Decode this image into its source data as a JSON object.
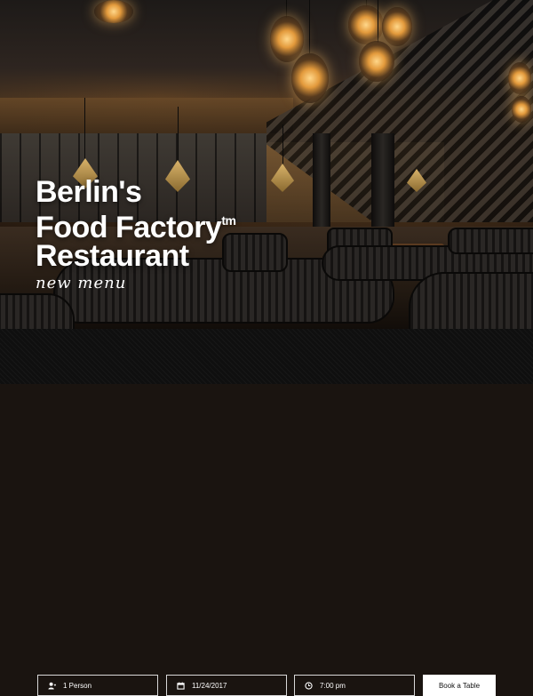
{
  "hero": {
    "title_line1": "Berlin's",
    "title_line2": "Food Factory",
    "title_tm": "tm",
    "title_line3": "Restaurant",
    "subtitle": "new menu"
  },
  "booking": {
    "guests": {
      "value": "1 Person",
      "icon": "person-icon"
    },
    "date": {
      "value": "11/24/2017",
      "icon": "calendar-icon"
    },
    "time": {
      "value": "7:00 pm",
      "icon": "clock-icon"
    },
    "submit_label": "Book a Table"
  },
  "colors": {
    "bar_background": "#0f0f0f",
    "text": "#ffffff",
    "button_background": "#ffffff",
    "button_text": "#111111"
  }
}
